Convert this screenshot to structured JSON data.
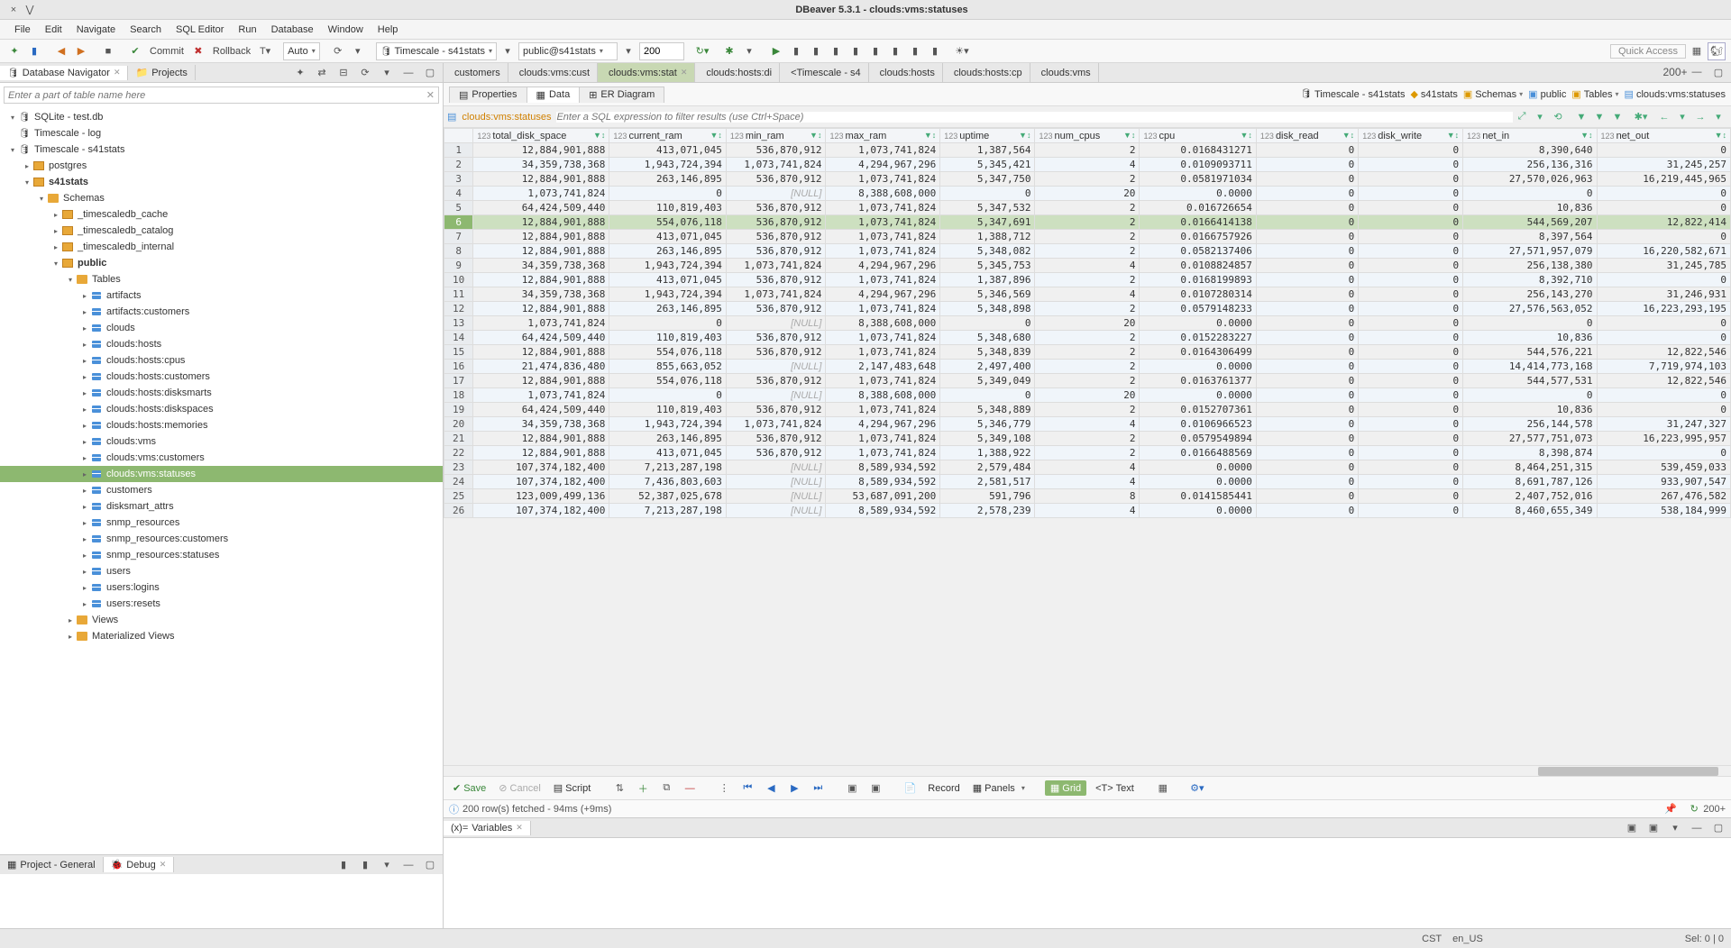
{
  "window": {
    "title": "DBeaver 5.3.1 - clouds:vms:statuses",
    "close": "×",
    "min": "⋁",
    "square": "□"
  },
  "menu": [
    "File",
    "Edit",
    "Navigate",
    "Search",
    "SQL Editor",
    "Run",
    "Database",
    "Window",
    "Help"
  ],
  "toolbar": {
    "commit": "Commit",
    "rollback": "Rollback",
    "auto": "Auto",
    "conn1": "Timescale - s41stats",
    "conn2": "public@s41stats",
    "rows": "200",
    "quick_access": "Quick Access"
  },
  "left": {
    "nav_tab": "Database Navigator",
    "proj_tab": "Projects",
    "search_placeholder": "Enter a part of table name here",
    "project_general": "Project - General",
    "debug": "Debug",
    "tree": [
      {
        "d": 0,
        "a": "▾",
        "ic": "db",
        "t": "SQLite - test.db"
      },
      {
        "d": 0,
        "a": "",
        "ic": "db",
        "t": "Timescale - log"
      },
      {
        "d": 0,
        "a": "▾",
        "ic": "db",
        "t": "Timescale - s41stats"
      },
      {
        "d": 1,
        "a": "▸",
        "ic": "sch",
        "t": "postgres"
      },
      {
        "d": 1,
        "a": "▾",
        "ic": "sch",
        "t": "s41stats",
        "bold": true
      },
      {
        "d": 2,
        "a": "▾",
        "ic": "fold",
        "t": "Schemas"
      },
      {
        "d": 3,
        "a": "▸",
        "ic": "sch",
        "t": "_timescaledb_cache"
      },
      {
        "d": 3,
        "a": "▸",
        "ic": "sch",
        "t": "_timescaledb_catalog"
      },
      {
        "d": 3,
        "a": "▸",
        "ic": "sch",
        "t": "_timescaledb_internal"
      },
      {
        "d": 3,
        "a": "▾",
        "ic": "sch",
        "t": "public",
        "bold": true
      },
      {
        "d": 4,
        "a": "▾",
        "ic": "fold",
        "t": "Tables"
      },
      {
        "d": 5,
        "a": "▸",
        "ic": "tbl",
        "t": "artifacts"
      },
      {
        "d": 5,
        "a": "▸",
        "ic": "tbl",
        "t": "artifacts:customers"
      },
      {
        "d": 5,
        "a": "▸",
        "ic": "tbl",
        "t": "clouds"
      },
      {
        "d": 5,
        "a": "▸",
        "ic": "tbl",
        "t": "clouds:hosts"
      },
      {
        "d": 5,
        "a": "▸",
        "ic": "tbl",
        "t": "clouds:hosts:cpus"
      },
      {
        "d": 5,
        "a": "▸",
        "ic": "tbl",
        "t": "clouds:hosts:customers"
      },
      {
        "d": 5,
        "a": "▸",
        "ic": "tbl",
        "t": "clouds:hosts:disksmarts"
      },
      {
        "d": 5,
        "a": "▸",
        "ic": "tbl",
        "t": "clouds:hosts:diskspaces"
      },
      {
        "d": 5,
        "a": "▸",
        "ic": "tbl",
        "t": "clouds:hosts:memories"
      },
      {
        "d": 5,
        "a": "▸",
        "ic": "tbl",
        "t": "clouds:vms"
      },
      {
        "d": 5,
        "a": "▸",
        "ic": "tbl",
        "t": "clouds:vms:customers"
      },
      {
        "d": 5,
        "a": "▸",
        "ic": "tbl",
        "t": "clouds:vms:statuses",
        "sel": true
      },
      {
        "d": 5,
        "a": "▸",
        "ic": "tbl",
        "t": "customers"
      },
      {
        "d": 5,
        "a": "▸",
        "ic": "tbl",
        "t": "disksmart_attrs"
      },
      {
        "d": 5,
        "a": "▸",
        "ic": "tbl",
        "t": "snmp_resources"
      },
      {
        "d": 5,
        "a": "▸",
        "ic": "tbl",
        "t": "snmp_resources:customers"
      },
      {
        "d": 5,
        "a": "▸",
        "ic": "tbl",
        "t": "snmp_resources:statuses"
      },
      {
        "d": 5,
        "a": "▸",
        "ic": "tbl",
        "t": "users"
      },
      {
        "d": 5,
        "a": "▸",
        "ic": "tbl",
        "t": "users:logins"
      },
      {
        "d": 5,
        "a": "▸",
        "ic": "tbl",
        "t": "users:resets"
      },
      {
        "d": 4,
        "a": "▸",
        "ic": "fold",
        "t": "Views"
      },
      {
        "d": 4,
        "a": "▸",
        "ic": "fold",
        "t": "Materialized Views"
      }
    ]
  },
  "editor": {
    "tabs": [
      {
        "l": "customers"
      },
      {
        "l": "clouds:vms:cust"
      },
      {
        "l": "clouds:vms:stat",
        "active": true,
        "close": true
      },
      {
        "l": "clouds:hosts:di"
      },
      {
        "l": "<Timescale - s4"
      },
      {
        "l": "clouds:hosts"
      },
      {
        "l": "clouds:hosts:cp"
      },
      {
        "l": "clouds:vms"
      }
    ],
    "more": "200+",
    "subtabs": {
      "properties": "Properties",
      "data": "Data",
      "erdiagram": "ER Diagram"
    },
    "breadcrumb": {
      "conn": "Timescale - s41stats",
      "db": "s41stats",
      "schemas": "Schemas",
      "schema": "public",
      "tables": "Tables",
      "table": "clouds:vms:statuses"
    },
    "filter": {
      "name": "clouds:vms:statuses",
      "placeholder": "Enter a SQL expression to filter results (use Ctrl+Space)"
    },
    "columns": [
      "total_disk_space",
      "current_ram",
      "min_ram",
      "max_ram",
      "uptime",
      "num_cpus",
      "cpu",
      "disk_read",
      "disk_write",
      "net_in",
      "net_out"
    ],
    "coltype": "123",
    "rows": [
      [
        "12,884,901,888",
        "413,071,045",
        "536,870,912",
        "1,073,741,824",
        "1,387,564",
        "2",
        "0.0168431271",
        "0",
        "0",
        "8,390,640",
        "0"
      ],
      [
        "34,359,738,368",
        "1,943,724,394",
        "1,073,741,824",
        "4,294,967,296",
        "5,345,421",
        "4",
        "0.0109093711",
        "0",
        "0",
        "256,136,316",
        "31,245,257"
      ],
      [
        "12,884,901,888",
        "263,146,895",
        "536,870,912",
        "1,073,741,824",
        "5,347,750",
        "2",
        "0.0581971034",
        "0",
        "0",
        "27,570,026,963",
        "16,219,445,965"
      ],
      [
        "1,073,741,824",
        "0",
        "[NULL]",
        "8,388,608,000",
        "0",
        "20",
        "0.0000",
        "0",
        "0",
        "0",
        "0"
      ],
      [
        "64,424,509,440",
        "110,819,403",
        "536,870,912",
        "1,073,741,824",
        "5,347,532",
        "2",
        "0.016726654",
        "0",
        "0",
        "10,836",
        "0"
      ],
      [
        "12,884,901,888",
        "554,076,118",
        "536,870,912",
        "1,073,741,824",
        "5,347,691",
        "2",
        "0.0166414138",
        "0",
        "0",
        "544,569,207",
        "12,822,414"
      ],
      [
        "12,884,901,888",
        "413,071,045",
        "536,870,912",
        "1,073,741,824",
        "1,388,712",
        "2",
        "0.0166757926",
        "0",
        "0",
        "8,397,564",
        "0"
      ],
      [
        "12,884,901,888",
        "263,146,895",
        "536,870,912",
        "1,073,741,824",
        "5,348,082",
        "2",
        "0.0582137406",
        "0",
        "0",
        "27,571,957,079",
        "16,220,582,671"
      ],
      [
        "34,359,738,368",
        "1,943,724,394",
        "1,073,741,824",
        "4,294,967,296",
        "5,345,753",
        "4",
        "0.0108824857",
        "0",
        "0",
        "256,138,380",
        "31,245,785"
      ],
      [
        "12,884,901,888",
        "413,071,045",
        "536,870,912",
        "1,073,741,824",
        "1,387,896",
        "2",
        "0.0168199893",
        "0",
        "0",
        "8,392,710",
        "0"
      ],
      [
        "34,359,738,368",
        "1,943,724,394",
        "1,073,741,824",
        "4,294,967,296",
        "5,346,569",
        "4",
        "0.0107280314",
        "0",
        "0",
        "256,143,270",
        "31,246,931"
      ],
      [
        "12,884,901,888",
        "263,146,895",
        "536,870,912",
        "1,073,741,824",
        "5,348,898",
        "2",
        "0.0579148233",
        "0",
        "0",
        "27,576,563,052",
        "16,223,293,195"
      ],
      [
        "1,073,741,824",
        "0",
        "[NULL]",
        "8,388,608,000",
        "0",
        "20",
        "0.0000",
        "0",
        "0",
        "0",
        "0"
      ],
      [
        "64,424,509,440",
        "110,819,403",
        "536,870,912",
        "1,073,741,824",
        "5,348,680",
        "2",
        "0.0152283227",
        "0",
        "0",
        "10,836",
        "0"
      ],
      [
        "12,884,901,888",
        "554,076,118",
        "536,870,912",
        "1,073,741,824",
        "5,348,839",
        "2",
        "0.0164306499",
        "0",
        "0",
        "544,576,221",
        "12,822,546"
      ],
      [
        "21,474,836,480",
        "855,663,052",
        "[NULL]",
        "2,147,483,648",
        "2,497,400",
        "2",
        "0.0000",
        "0",
        "0",
        "14,414,773,168",
        "7,719,974,103"
      ],
      [
        "12,884,901,888",
        "554,076,118",
        "536,870,912",
        "1,073,741,824",
        "5,349,049",
        "2",
        "0.0163761377",
        "0",
        "0",
        "544,577,531",
        "12,822,546"
      ],
      [
        "1,073,741,824",
        "0",
        "[NULL]",
        "8,388,608,000",
        "0",
        "20",
        "0.0000",
        "0",
        "0",
        "0",
        "0"
      ],
      [
        "64,424,509,440",
        "110,819,403",
        "536,870,912",
        "1,073,741,824",
        "5,348,889",
        "2",
        "0.0152707361",
        "0",
        "0",
        "10,836",
        "0"
      ],
      [
        "34,359,738,368",
        "1,943,724,394",
        "1,073,741,824",
        "4,294,967,296",
        "5,346,779",
        "4",
        "0.0106966523",
        "0",
        "0",
        "256,144,578",
        "31,247,327"
      ],
      [
        "12,884,901,888",
        "263,146,895",
        "536,870,912",
        "1,073,741,824",
        "5,349,108",
        "2",
        "0.0579549894",
        "0",
        "0",
        "27,577,751,073",
        "16,223,995,957"
      ],
      [
        "12,884,901,888",
        "413,071,045",
        "536,870,912",
        "1,073,741,824",
        "1,388,922",
        "2",
        "0.0166488569",
        "0",
        "0",
        "8,398,874",
        "0"
      ],
      [
        "107,374,182,400",
        "7,213,287,198",
        "[NULL]",
        "8,589,934,592",
        "2,579,484",
        "4",
        "0.0000",
        "0",
        "0",
        "8,464,251,315",
        "539,459,033"
      ],
      [
        "107,374,182,400",
        "7,436,803,603",
        "[NULL]",
        "8,589,934,592",
        "2,581,517",
        "4",
        "0.0000",
        "0",
        "0",
        "8,691,787,126",
        "933,907,547"
      ],
      [
        "123,009,499,136",
        "52,387,025,678",
        "[NULL]",
        "53,687,091,200",
        "591,796",
        "8",
        "0.0141585441",
        "0",
        "0",
        "2,407,752,016",
        "267,476,582"
      ],
      [
        "107,374,182,400",
        "7,213,287,198",
        "[NULL]",
        "8,589,934,592",
        "2,578,239",
        "4",
        "0.0000",
        "0",
        "0",
        "8,460,655,349",
        "538,184,999"
      ]
    ],
    "selected_row": 6,
    "btoolbar": {
      "save": "Save",
      "cancel": "Cancel",
      "script": "Script",
      "record": "Record",
      "panels": "Panels",
      "grid": "Grid",
      "text": "Text"
    },
    "status": "200 row(s) fetched - 94ms (+9ms)",
    "variables": "Variables"
  },
  "statusbar": {
    "tz": "CST",
    "locale": "en_US",
    "sel": "Sel: 0 | 0"
  }
}
